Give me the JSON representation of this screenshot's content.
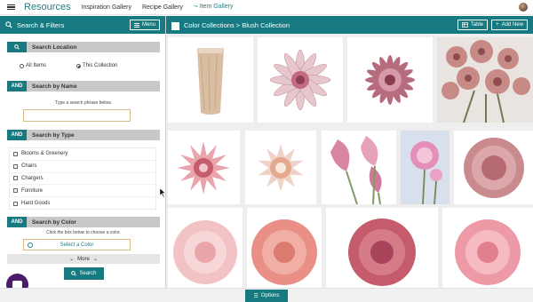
{
  "topnav": {
    "brand": "Resources",
    "links": [
      "Inspiration Gallery",
      "Recipe Gallery",
      "Item Gallery"
    ],
    "active_tag": "⤳"
  },
  "left_panel": {
    "title": "Search & Filters",
    "menu_label": "Menu",
    "location": {
      "label": "Search Location",
      "options": [
        "All Items",
        "This Collection"
      ],
      "selected": "This Collection"
    },
    "by_name": {
      "badge": "AND",
      "label": "Search by Name",
      "hint": "Type a search phrase below.",
      "placeholder": ""
    },
    "by_type": {
      "badge": "AND",
      "label": "Search by Type",
      "items": [
        "Blooms & Greenery",
        "Chairs",
        "Chargers",
        "Furniture",
        "Hard Goods"
      ]
    },
    "by_color": {
      "badge": "AND",
      "label": "Search by Color",
      "hint": "Click the box below to choose a color.",
      "button": "Select a Color"
    },
    "more_label": "More",
    "search_label": "Search"
  },
  "right_panel": {
    "breadcrumb": "Color Collections > Blush Collection",
    "table_label": "Table",
    "add_new_label": "Add New"
  },
  "bottom": {
    "options_label": "Options"
  },
  "colors": {
    "accent": "#167a80",
    "link": "#1d7f88",
    "chat": "#4a1c6a"
  }
}
